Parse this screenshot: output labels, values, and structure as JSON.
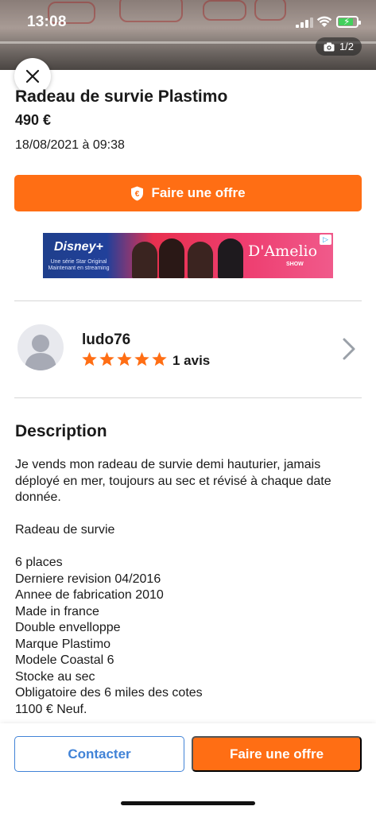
{
  "status_bar": {
    "time": "13:08"
  },
  "photo": {
    "counter": "1/2",
    "camera_icon": "camera-icon"
  },
  "listing": {
    "title": "Radeau de survie Plastimo",
    "price": "490 €",
    "date": "18/08/2021 à 09:38",
    "offer_button_label": "Faire une offre"
  },
  "ad": {
    "brand": "Disney+",
    "tagline": "Une série Star Original Maintenant en streaming",
    "show_name": "D'Amelio",
    "show_subtitle": "SHOW"
  },
  "seller": {
    "name": "ludo76",
    "rating_stars": 5,
    "reviews": "1 avis"
  },
  "description": {
    "heading": "Description",
    "paragraph": "Je vends mon radeau de survie demi hauturier, jamais déployé en mer, toujours au sec et révisé à chaque date donnée.",
    "category": "Radeau de survie",
    "details": [
      "6 places",
      "Derniere revision 04/2016",
      "Annee de fabrication 2010",
      "Made in france",
      "Double envelloppe",
      "Marque Plastimo",
      "Modele Coastal 6",
      "Stocke au sec",
      "Obligatoire des 6 miles des cotes",
      "1100 € Neuf."
    ]
  },
  "bottom_bar": {
    "contact_label": "Contacter",
    "offer_label": "Faire une offre"
  },
  "colors": {
    "accent_orange": "#ff6e14",
    "link_blue": "#4183d7",
    "star_orange": "#ff6e14"
  }
}
